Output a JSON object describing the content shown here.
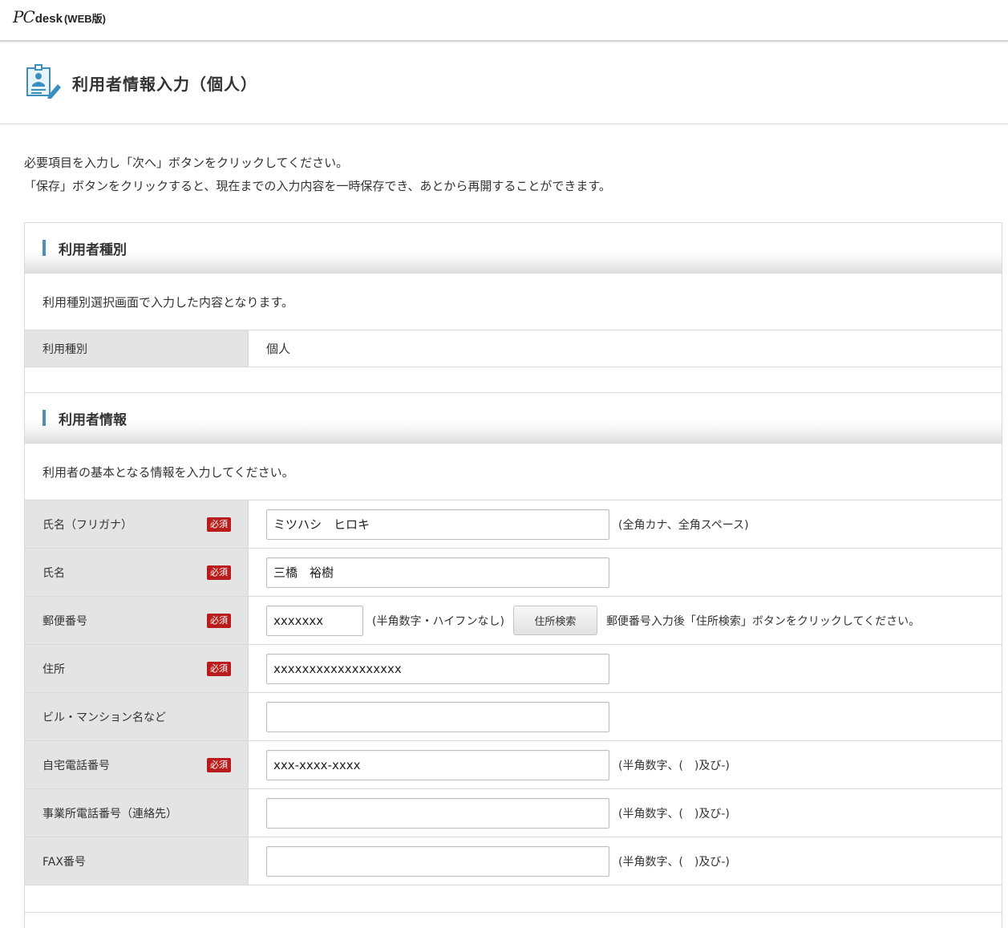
{
  "header": {
    "logo_pc": "PC",
    "logo_desk": "desk",
    "logo_web": "(WEB版)"
  },
  "page": {
    "title": "利用者情報入力（個人）",
    "icon": "user-profile-edit-icon"
  },
  "instructions": {
    "line1": "必要項目を入力し「次へ」ボタンをクリックしてください。",
    "line2": "「保存」ボタンをクリックすると、現在までの入力内容を一時保存でき、あとから再開することができます。"
  },
  "colors": {
    "accent_bar": "#4a90b8",
    "required_badge": "#b81c1c",
    "label_bg": "#e4e4e4"
  },
  "section_type": {
    "title": "利用者種別",
    "description": "利用種別選択画面で入力した内容となります。",
    "row_label": "利用種別",
    "row_value": "個人"
  },
  "section_info": {
    "title": "利用者情報",
    "description": "利用者の基本となる情報を入力してください。",
    "required_label": "必須",
    "fields": {
      "kana": {
        "label": "氏名（フリガナ）",
        "value": "ミツハシ　ヒロキ",
        "hint": "(全角カナ、全角スペース)"
      },
      "name": {
        "label": "氏名",
        "value": "三橋　裕樹"
      },
      "postal": {
        "label": "郵便番号",
        "value": "xxxxxxx",
        "hint": "(半角数字・ハイフンなし)",
        "button": "住所検索",
        "note": "郵便番号入力後「住所検索」ボタンをクリックしてください。"
      },
      "address": {
        "label": "住所",
        "value": "xxxxxxxxxxxxxxxxxx"
      },
      "building": {
        "label": "ビル・マンション名など",
        "value": ""
      },
      "home_phone": {
        "label": "自宅電話番号",
        "value": "xxx-xxxx-xxxx",
        "hint": "(半角数字、(　)及び-)"
      },
      "office_phone": {
        "label": "事業所電話番号（連絡先）",
        "value": "",
        "hint": "(半角数字、(　)及び-)"
      },
      "fax": {
        "label": "FAX番号",
        "value": "",
        "hint": "(半角数字、(　)及び-)"
      }
    }
  }
}
